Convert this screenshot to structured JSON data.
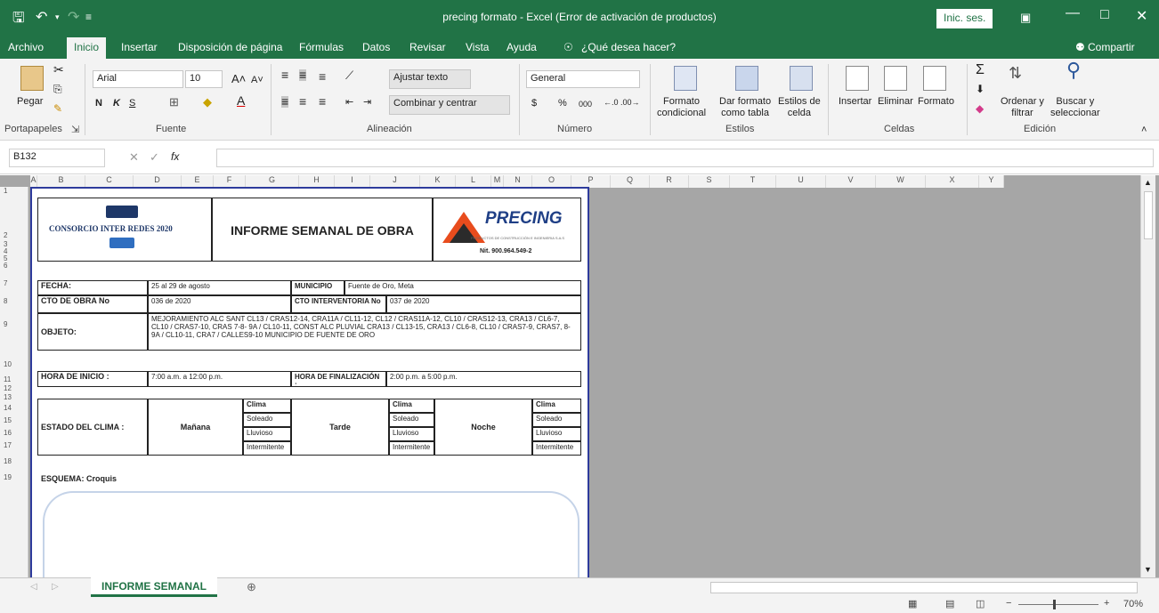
{
  "window": {
    "title": "precing formato  -  Excel (Error de activación de productos)",
    "signin_label": "Inic. ses."
  },
  "menu": {
    "tabs": [
      "Archivo",
      "Inicio",
      "Insertar",
      "Disposición de página",
      "Fórmulas",
      "Datos",
      "Revisar",
      "Vista",
      "Ayuda"
    ],
    "tell_me": "¿Qué desea hacer?",
    "share": "Compartir"
  },
  "ribbon": {
    "paste_label": "Pegar",
    "font_name": "Arial",
    "font_size": "10",
    "bold": "N",
    "italic": "K",
    "underline": "S",
    "wrap_text": "Ajustar texto",
    "merge_center": "Combinar y centrar",
    "number_format": "General",
    "currency": "$",
    "percent": "%",
    "thousands": "000",
    "cond_format": [
      "Formato",
      "condicional"
    ],
    "format_table": [
      "Dar formato",
      "como tabla"
    ],
    "cell_styles": [
      "Estilos de",
      "celda"
    ],
    "insert": "Insertar",
    "delete": "Eliminar",
    "format": "Formato",
    "sort_filter": [
      "Ordenar y",
      "filtrar"
    ],
    "find_select": [
      "Buscar y",
      "seleccionar"
    ],
    "groups": [
      "Portapapeles",
      "Fuente",
      "Alineación",
      "Número",
      "Estilos",
      "Celdas",
      "Edición"
    ]
  },
  "formula_bar": {
    "name_box": "B132",
    "fx": "fx",
    "content": ""
  },
  "columns": [
    "A",
    "B",
    "C",
    "D",
    "E",
    "F",
    "G",
    "H",
    "I",
    "J",
    "K",
    "L",
    "M",
    "N",
    "O",
    "P",
    "Q",
    "R",
    "S",
    "T",
    "U",
    "V",
    "W",
    "X",
    "Y"
  ],
  "rows": [
    "1",
    "2",
    "3",
    "4",
    "5",
    "6",
    "7",
    "8",
    "9",
    "10",
    "11",
    "12",
    "13",
    "14",
    "15",
    "16",
    "17",
    "18",
    "19"
  ],
  "doc": {
    "consortium": "CONSORCIO INTER REDES 2020",
    "heading": "INFORME SEMANAL DE OBRA",
    "brand": "PRECING",
    "brand_tagline": "PRODUCTOS DE CONSTRUCCIÓN E INGENIERIA S.A.S",
    "nit": "Nit. 900.964.549-2",
    "fecha_label": "FECHA:",
    "fecha_value": "25 al 29  de agosto",
    "municipio_label": "MUNICIPIO",
    "municipio_value": "Fuente de Oro, Meta",
    "cto_obra_label": "CTO DE OBRA No",
    "cto_obra_value": "036 de 2020",
    "cto_int_label": "CTO INTERVENTORIA No",
    "cto_int_value": "037 de 2020",
    "objeto_label": "OBJETO:",
    "objeto_value": "MEJORAMIENTO ALC SANT CL13 / CRAS12-14, CRA11A / CL11-12, CL12 / CRAS11A-12, CL10 / CRAS12-13, CRA13 / CL6-7, CL10 / CRAS7-10, CRAS 7-8- 9A / CL10-11, CONST ALC PLUVIAL CRA13 / CL13-15, CRA13 / CL6-8, CL10 / CRAS7-9, CRAS7, 8-9A / CL10-11, CRA7 / CALLES9-10 MUNICIPIO DE FUENTE DE ORO",
    "hora_inicio_label": "HORA DE INICIO :",
    "hora_inicio_value": "7:00 a.m. a 12:00 p.m.",
    "hora_fin_label": "HORA DE FINALIZACIÓN :",
    "hora_fin_value": "2:00 p.m. a 5:00 p.m.",
    "clima_label": "ESTADO DEL CLIMA :",
    "manana": "Mañana",
    "tarde": "Tarde",
    "noche": "Noche",
    "clima": "Clima",
    "soleado": "Soleado",
    "lluvioso": "Lluvioso",
    "intermitente": "Intermitente",
    "esquema_label": "ESQUEMA: Croquis"
  },
  "sheet_tab": "INFORME SEMANAL",
  "zoom": "70%"
}
